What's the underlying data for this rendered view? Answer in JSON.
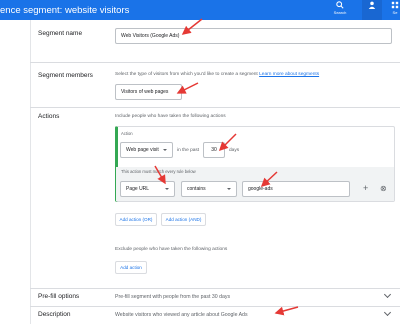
{
  "header": {
    "title": "ence segment: website visitors",
    "actions": [
      {
        "name": "search-action",
        "label": "Search"
      },
      {
        "name": "help-action",
        "label": ""
      },
      {
        "name": "settings-action",
        "label": "Se"
      }
    ]
  },
  "segment_name": {
    "label": "Segment name",
    "value": "Web Visitors (Google Ads)"
  },
  "segment_members": {
    "label": "Segment members",
    "hint": "Select the type of visitors from which you'd like to create a segment",
    "link": "Learn more about segments",
    "selected": "Visitors of web pages"
  },
  "actions": {
    "label": "Actions",
    "include_hint": "Include people who have taken the following actions",
    "action_title": "Action",
    "action_type": "Web page visit",
    "in_the_past": "in the past",
    "days_value": "30",
    "days_unit": "days",
    "rule_hint": "This action must match every rule below",
    "rule_field": "Page URL",
    "rule_operator": "contains",
    "rule_value": "google-ads",
    "plus_symbol": "+",
    "remove_symbol": "⊗",
    "add_or": "Add action (OR)",
    "add_and": "Add action (AND)",
    "exclude_hint": "Exclude people who have taken the following actions",
    "add_action": "Add action"
  },
  "prefill": {
    "label": "Pre-fill options",
    "value": "Pre-fill segment with people from the past 30 days"
  },
  "description": {
    "label": "Description",
    "value": "Website visitors who viewed any article about Google Ads"
  },
  "colors": {
    "header_blue": "#1a73e8",
    "link_blue": "#1a73e8",
    "accent_green": "#34a853",
    "annotation_red": "#e53935"
  }
}
